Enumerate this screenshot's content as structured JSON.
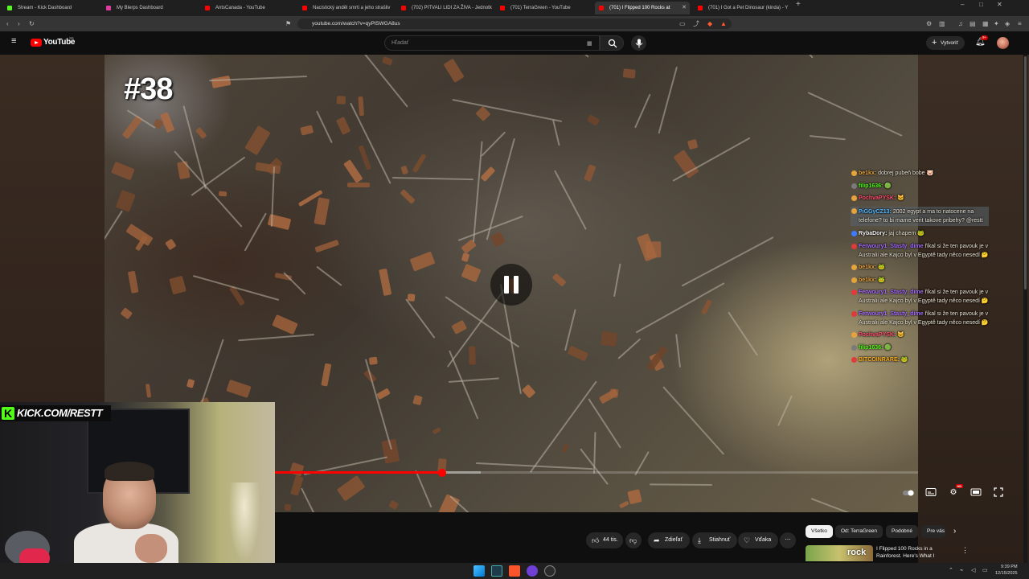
{
  "tabs": [
    {
      "title": "Stream - Kick Dashboard",
      "color": "#53fc18"
    },
    {
      "title": "My Blerps Dashboard",
      "color": "#e03ca0"
    },
    {
      "title": "AntsCanada - YouTube",
      "color": "#ff0000"
    },
    {
      "title": "Nacistický anděl smrti a jeho strašliv",
      "color": "#ff0000"
    },
    {
      "title": "(702) PITVALI LIDI ZA ŽIVA - Jednotk",
      "color": "#ff0000"
    },
    {
      "title": "(701) TerraGreen - YouTube",
      "color": "#ff0000"
    },
    {
      "title": "(701) I Flipped 100 Rocks at",
      "color": "#ff0000"
    },
    {
      "title": "(701) I Got a Pet Dinosaur (kinda) - Y",
      "color": "#ff0000"
    }
  ],
  "browser": {
    "url": "youtube.com/watch?v=qyPlSWGA8us",
    "new_tab": "+",
    "min": "–",
    "max": "□",
    "close": "✕"
  },
  "masthead": {
    "logo": "YouTube",
    "country": "SK",
    "search_placeholder": "Hľadať",
    "create_label": "Vytvoriť",
    "notification_count": "9+"
  },
  "video": {
    "episode_badge": "#38",
    "progress_fraction": 0.26,
    "buffered_fraction": 0.32
  },
  "chat": [
    {
      "user": "be1kx:",
      "msg": "dobrej pubeň bobe 🐷",
      "color": "#e7a33b",
      "badge": "#e7a33b"
    },
    {
      "user": "filip1636:",
      "msg": "🟢",
      "color": "#53fc18",
      "badge": "#7a7a7a"
    },
    {
      "user": "PochvaPYSK:",
      "msg": "🐱",
      "color": "#ff4f6e",
      "badge": "#e7a33b"
    },
    {
      "user": "PiGGyCZ13:",
      "msg": "2002 egypt a ma to natocene na telefone? to bi mame verit takove pribehy? @restt",
      "color": "#53b9ff",
      "badge": "#e7a33b",
      "highlight": true
    },
    {
      "user": "RybaDory:",
      "msg": "jaj chapem 🐸",
      "color": "#f4f4f4",
      "badge": "#3b7bff"
    },
    {
      "user": "Ferwoury1_Stasty_dime",
      "msg": "říkal si že ten pavouk je v Australii ale Kajco byl v Egyptě tady něco nesedí 🤔",
      "color": "#a46bff",
      "badge": "#e03a3a"
    },
    {
      "user": "be1kx:",
      "msg": "🐸",
      "color": "#e7a33b",
      "badge": "#e7a33b"
    },
    {
      "user": "be1kx:",
      "msg": "🐸",
      "color": "#e7a33b",
      "badge": "#e7a33b"
    },
    {
      "user": "Ferwoury1_Stasty_dime",
      "msg": "říkal si že ten pavouk je v Australii ale Kajco byl v Egyptě tady něco nesedí 🤔",
      "color": "#a46bff",
      "badge": "#e03a3a"
    },
    {
      "user": "Ferwoury1_Stasty_dime",
      "msg": "říkal si že ten pavouk je v Australii ale Kajco byl v Egyptě tady něco nesedí 🤔",
      "color": "#a46bff",
      "badge": "#e03a3a"
    },
    {
      "user": "PochvaPYSK:",
      "msg": "🐱",
      "color": "#ff4f6e",
      "badge": "#e7a33b"
    },
    {
      "user": "filip1636:",
      "msg": "🟢",
      "color": "#53fc18",
      "badge": "#7a7a7a"
    },
    {
      "user": "BITCOINRARE:",
      "msg": "🐸",
      "color": "#ffb21f",
      "badge": "#e03a3a"
    }
  ],
  "webcam": {
    "kick_letter": "K",
    "kick_url": "KICK.COM/RESTT"
  },
  "actions": {
    "like_count": "44 tis.",
    "share": "Zdieľať",
    "download": "Stiahnuť",
    "thanks": "Vďaka",
    "more": "⋯"
  },
  "filters": [
    "Všetko",
    "Od: TerraGreen",
    "Podobné",
    "Pre vás"
  ],
  "recommendation": {
    "thumb_text": "rock",
    "title": "I Flipped 100 Rocks in a Rainforest. Here's What I"
  },
  "taskbar": {
    "time": "9:39 PM",
    "date": "12/15/2025"
  }
}
